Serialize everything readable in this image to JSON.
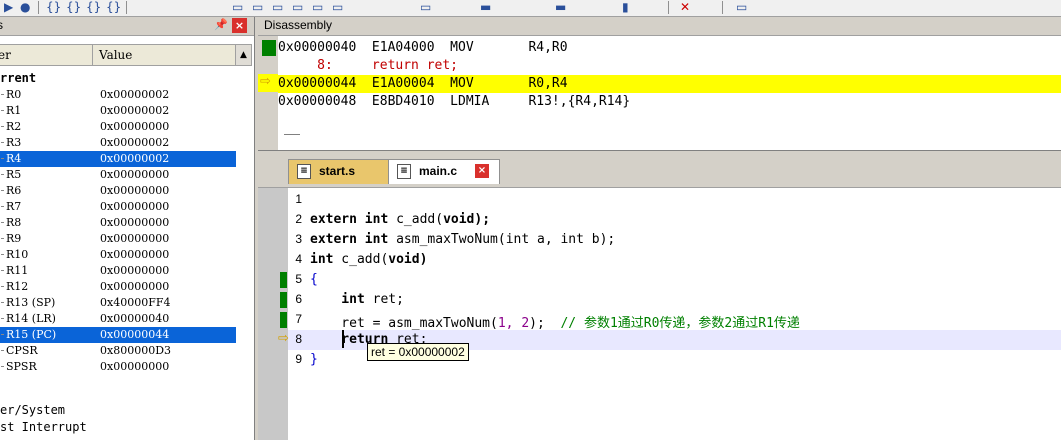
{
  "registers": {
    "title": "s",
    "col_name": "er",
    "col_value": "Value",
    "group_current": "rrent",
    "rows": [
      {
        "name": "R0",
        "value": "0x00000002"
      },
      {
        "name": "R1",
        "value": "0x00000002"
      },
      {
        "name": "R2",
        "value": "0x00000000"
      },
      {
        "name": "R3",
        "value": "0x00000002"
      },
      {
        "name": "R4",
        "value": "0x00000002"
      },
      {
        "name": "R5",
        "value": "0x00000000"
      },
      {
        "name": "R6",
        "value": "0x00000000"
      },
      {
        "name": "R7",
        "value": "0x00000000"
      },
      {
        "name": "R8",
        "value": "0x00000000"
      },
      {
        "name": "R9",
        "value": "0x00000000"
      },
      {
        "name": "R10",
        "value": "0x00000000"
      },
      {
        "name": "R11",
        "value": "0x00000000"
      },
      {
        "name": "R12",
        "value": "0x00000000"
      },
      {
        "name": "R13 (SP)",
        "value": "0x40000FF4"
      },
      {
        "name": "R14 (LR)",
        "value": "0x00000040"
      },
      {
        "name": "R15 (PC)",
        "value": "0x00000044"
      },
      {
        "name": "CPSR",
        "value": "0x800000D3"
      },
      {
        "name": "SPSR",
        "value": "0x00000000"
      }
    ],
    "group_user": "er/System",
    "group_fiq": "st Interrupt"
  },
  "disassembly": {
    "title": "Disassembly",
    "lines": [
      {
        "text": "0x00000040  E1A04000  MOV       R4,R0"
      },
      {
        "text": "     8:     return ret;"
      },
      {
        "text": "0x00000044  E1A00004  MOV       R0,R4"
      },
      {
        "text": "0x00000048  E8BD4010  LDMIA     R13!,{R4,R14}"
      }
    ]
  },
  "editor": {
    "tabs": [
      {
        "label": "start.s"
      },
      {
        "label": "main.c"
      }
    ],
    "lines": [
      {
        "n": "1",
        "p1": "",
        "p2": "",
        "p3": ""
      },
      {
        "n": "2",
        "p1": "extern int",
        "p2": " c_add(",
        "p3": "void);"
      },
      {
        "n": "3",
        "p1": "extern int",
        "p2": " asm_maxTwoNum(",
        "p3": "int a, int b);"
      },
      {
        "n": "4",
        "p1": "int",
        "p2": " c_add(",
        "p3": "void)"
      },
      {
        "n": "5",
        "p1": "{",
        "p2": "",
        "p3": ""
      },
      {
        "n": "6",
        "p1": "    int",
        "p2": " ret;",
        "p3": ""
      },
      {
        "n": "7",
        "p1": "    ret = asm_maxTwoNum(",
        "p2": "1, 2",
        "p3": ");",
        "comment": "  // 参数1通过R0传递，参数2通过R1传递"
      },
      {
        "n": "8",
        "p1": "    return",
        "p2": " ret;",
        "p3": ""
      },
      {
        "n": "9",
        "p1": "}",
        "p2": "",
        "p3": ""
      }
    ],
    "tooltip": "ret = 0x00000002"
  }
}
